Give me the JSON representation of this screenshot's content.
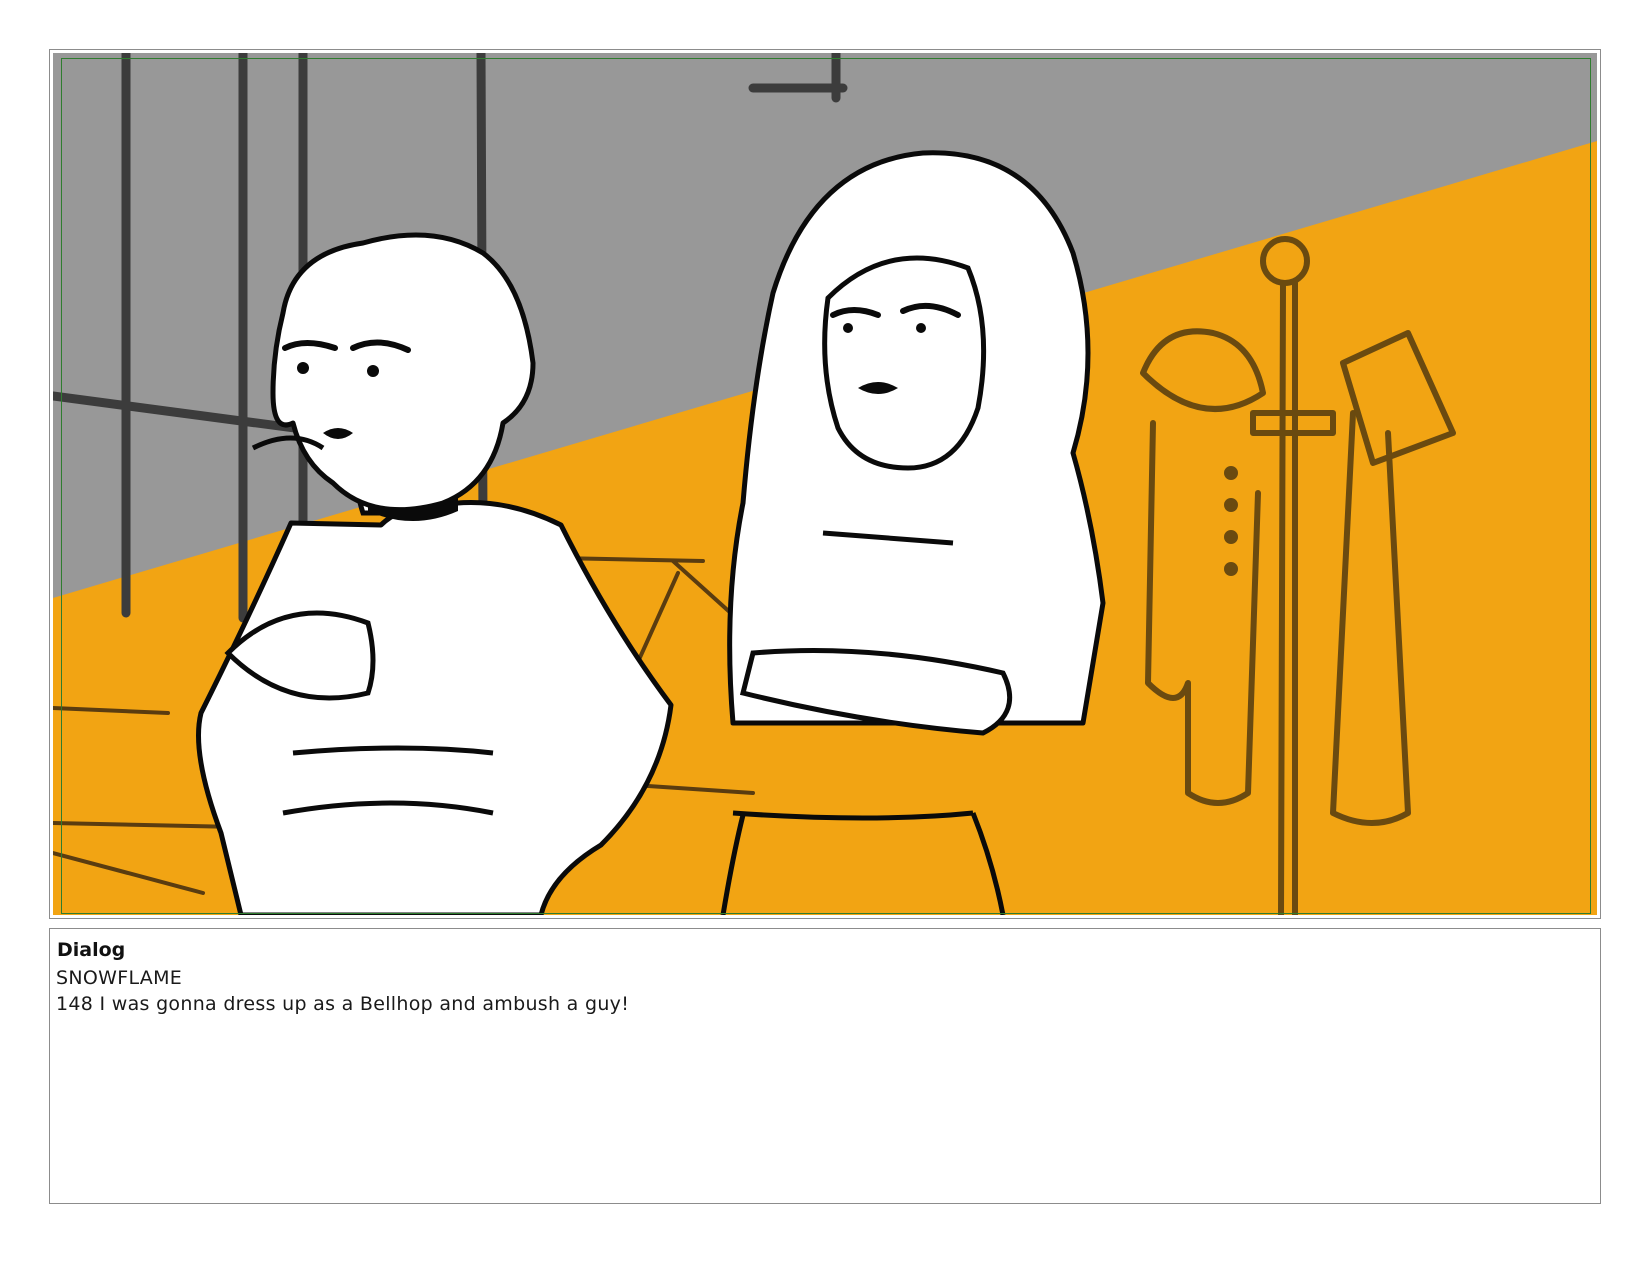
{
  "panel": {
    "colors": {
      "wall": "#989898",
      "light": "#f2a413",
      "ink": "#0a0a0a",
      "prop_ink": "#6a4a10",
      "safe_frame": "#2f7d2f"
    },
    "icons": [
      "storyboard-panel-drawing"
    ]
  },
  "dialog": {
    "heading": "Dialog",
    "character": "SNOWFLAME",
    "line": "148 I was gonna dress up as a Bellhop and ambush a guy!"
  }
}
